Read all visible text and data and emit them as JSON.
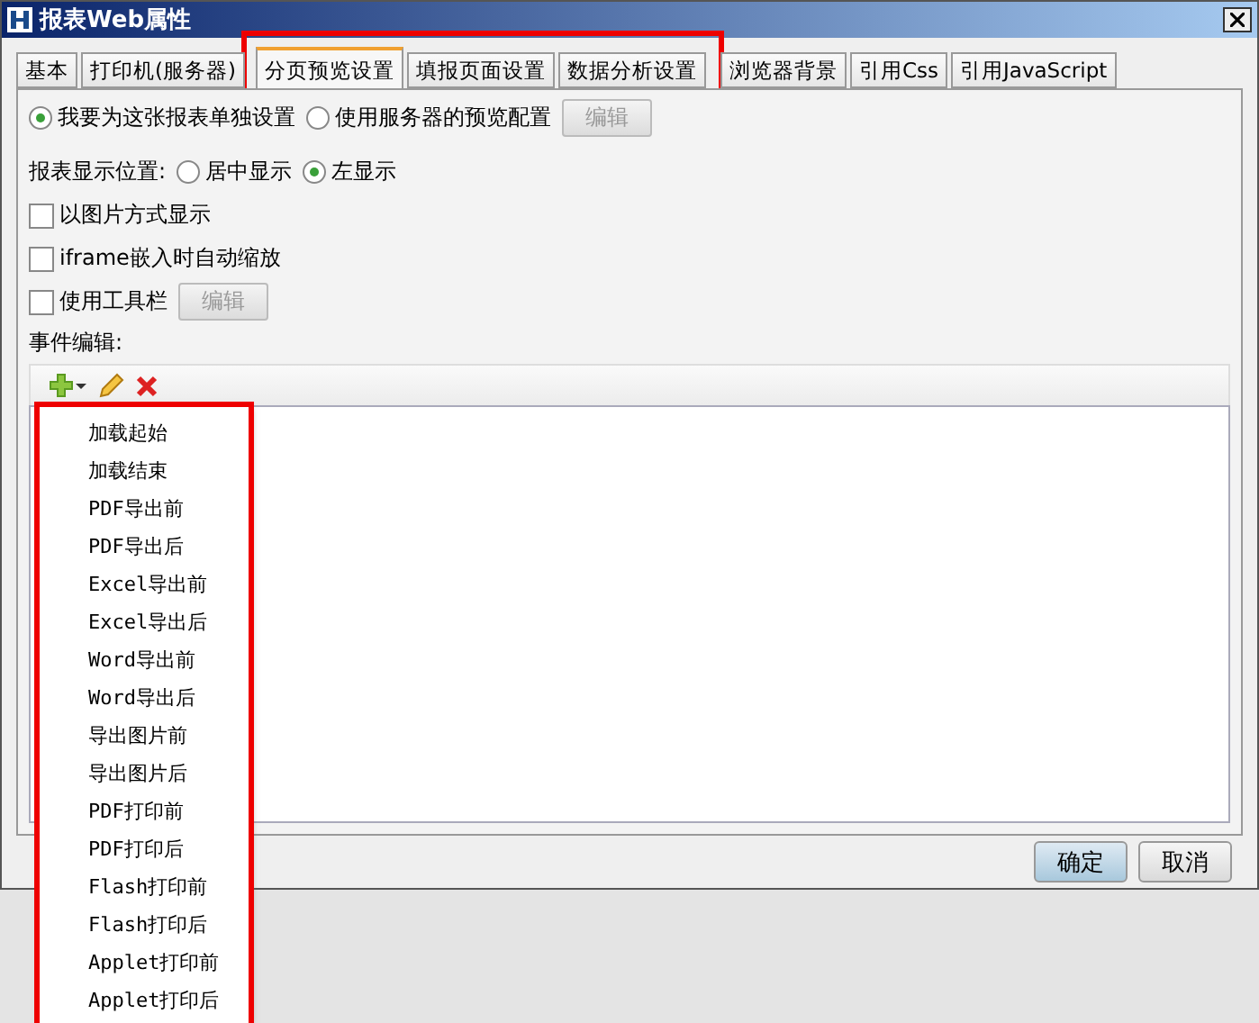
{
  "window": {
    "title": "报表Web属性"
  },
  "tabs": [
    {
      "label": "基本",
      "selected": false,
      "highlighted": false
    },
    {
      "label": "打印机(服务器)",
      "selected": false,
      "highlighted": false
    },
    {
      "label": "分页预览设置",
      "selected": true,
      "highlighted": true
    },
    {
      "label": "填报页面设置",
      "selected": false,
      "highlighted": true
    },
    {
      "label": "数据分析设置",
      "selected": false,
      "highlighted": true
    },
    {
      "label": "浏览器背景",
      "selected": false,
      "highlighted": false
    },
    {
      "label": "引用Css",
      "selected": false,
      "highlighted": false
    },
    {
      "label": "引用JavaScript",
      "selected": false,
      "highlighted": false
    }
  ],
  "mode_options": [
    {
      "label": "我要为这张报表单独设置",
      "selected": true
    },
    {
      "label": "使用服务器的预览配置",
      "selected": false
    }
  ],
  "mode_edit_button": {
    "label": "编辑",
    "disabled": true
  },
  "display_position": {
    "label": "报表显示位置:",
    "options": [
      {
        "label": "居中显示",
        "selected": false
      },
      {
        "label": "左显示",
        "selected": true
      }
    ]
  },
  "checkboxes": [
    {
      "label": "以图片方式显示",
      "checked": false
    },
    {
      "label": "iframe嵌入时自动缩放",
      "checked": false
    },
    {
      "label": "使用工具栏",
      "checked": false,
      "button": {
        "label": "编辑",
        "disabled": true
      }
    }
  ],
  "events_label": "事件编辑:",
  "event_menu": {
    "highlighted": true,
    "items": [
      "加载起始",
      "加载结束",
      "PDF导出前",
      "PDF导出后",
      "Excel导出前",
      "Excel导出后",
      "Word导出前",
      "Word导出后",
      "导出图片前",
      "导出图片后",
      "PDF打印前",
      "PDF打印后",
      "Flash打印前",
      "Flash打印后",
      "Applet打印前",
      "Applet打印后"
    ]
  },
  "buttons": [
    {
      "label": "确定",
      "default": true
    },
    {
      "label": "取消",
      "default": false
    }
  ]
}
